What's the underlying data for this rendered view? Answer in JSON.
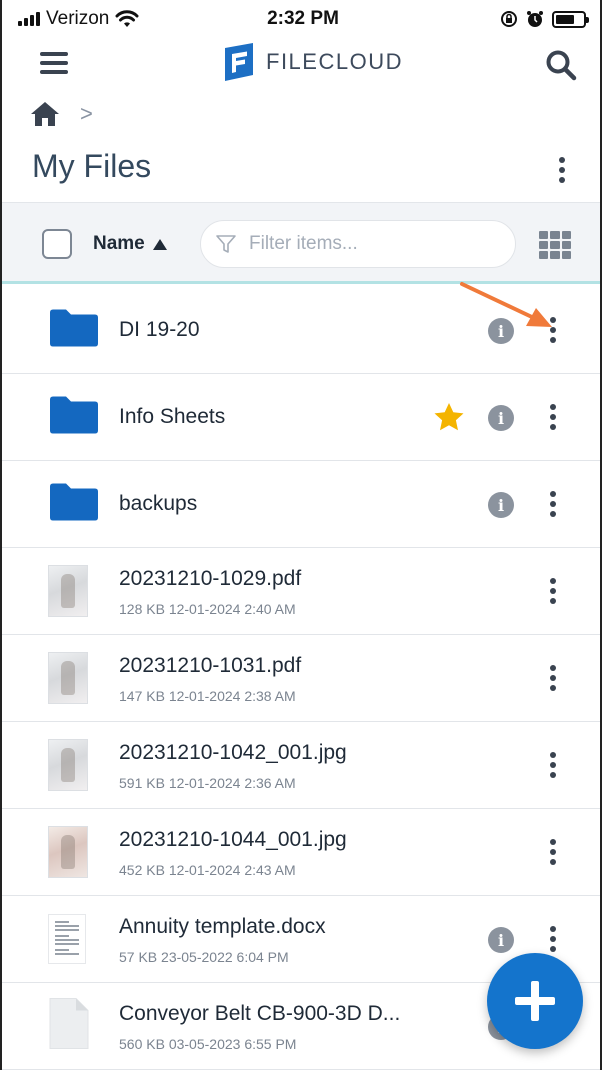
{
  "status_bar": {
    "carrier": "Verizon",
    "time": "2:32 PM",
    "icons": [
      "signal-icon",
      "wifi-icon",
      "rotation-lock-icon",
      "alarm-icon",
      "battery-icon"
    ]
  },
  "header": {
    "brand": "FILECLOUD",
    "menu_icon": "hamburger-menu-icon",
    "search_icon": "search-icon",
    "logo_color": "#1d6fc4"
  },
  "breadcrumb": {
    "home_icon": "home-icon",
    "separator": ">"
  },
  "page": {
    "title": "My Files",
    "more_icon": "vertical-dots-icon"
  },
  "toolbar": {
    "sort_label": "Name",
    "sort_direction": "ascending",
    "filter_placeholder": "Filter items...",
    "filter_value": "",
    "view_icon": "grid-view-icon"
  },
  "files": [
    {
      "name": "DI 19-20",
      "type": "folder",
      "meta": "",
      "info": true,
      "starred": false
    },
    {
      "name": "Info Sheets",
      "type": "folder",
      "meta": "",
      "info": true,
      "starred": true
    },
    {
      "name": "backups",
      "type": "folder",
      "meta": "",
      "info": true,
      "starred": false
    },
    {
      "name": "20231210-1029.pdf",
      "type": "image",
      "meta": "128 KB 12-01-2024 2:40 AM",
      "info": false,
      "starred": false
    },
    {
      "name": "20231210-1031.pdf",
      "type": "image",
      "meta": "147 KB 12-01-2024 2:38 AM",
      "info": false,
      "starred": false
    },
    {
      "name": "20231210-1042_001.jpg",
      "type": "image",
      "meta": "591 KB 12-01-2024 2:36 AM",
      "info": false,
      "starred": false
    },
    {
      "name": "20231210-1044_001.jpg",
      "type": "image-warm",
      "meta": "452 KB 12-01-2024 2:43 AM",
      "info": false,
      "starred": false
    },
    {
      "name": "Annuity template.docx",
      "type": "document",
      "meta": "57 KB 23-05-2022 6:04 PM",
      "info": true,
      "starred": false
    },
    {
      "name": "Conveyor Belt CB-900-3D D...",
      "type": "blank",
      "meta": "560 KB 03-05-2023 6:55 PM",
      "info": true,
      "starred": false
    }
  ],
  "fab": {
    "icon": "plus-icon"
  },
  "colors": {
    "folder": "#1468c0",
    "accent": "#1474cc",
    "star": "#f4b400",
    "annotation_arrow": "#f07a3a"
  }
}
